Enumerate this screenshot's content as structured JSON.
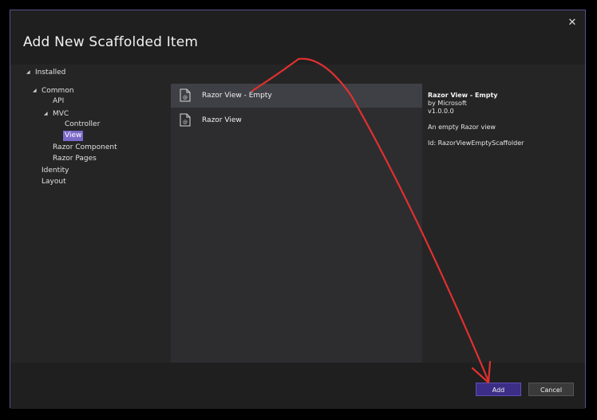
{
  "dialog": {
    "title": "Add New Scaffolded Item",
    "close_glyph": "✕"
  },
  "tree": {
    "installed": "Installed",
    "common": "Common",
    "api": "API",
    "mvc": "MVC",
    "controller": "Controller",
    "view": "View",
    "razor_component": "Razor Component",
    "razor_pages": "Razor Pages",
    "identity": "Identity",
    "layout": "Layout"
  },
  "list": {
    "items": [
      {
        "label": "Razor View - Empty",
        "icon": "razor-file-icon",
        "selected": true
      },
      {
        "label": "Razor View",
        "icon": "razor-file-icon",
        "selected": false
      }
    ]
  },
  "details": {
    "title": "Razor View - Empty",
    "author": "by Microsoft",
    "version": "v1.0.0.0",
    "description": "An empty Razor view",
    "id": "Id: RazorViewEmptyScaffolder"
  },
  "footer": {
    "add_label": "Add",
    "cancel_label": "Cancel"
  },
  "colors": {
    "accent": "#7b68c8",
    "add_button": "#3c2e86",
    "annotation_arrow": "#e03030"
  }
}
